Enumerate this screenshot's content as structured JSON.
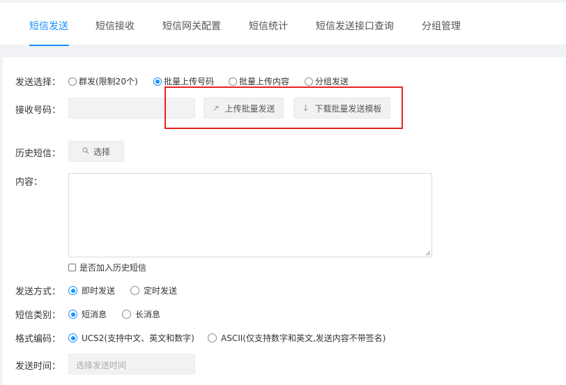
{
  "tabs": [
    {
      "label": "短信发送",
      "active": true
    },
    {
      "label": "短信接收",
      "active": false
    },
    {
      "label": "短信网关配置",
      "active": false
    },
    {
      "label": "短信统计",
      "active": false
    },
    {
      "label": "短信发送接口查询",
      "active": false
    },
    {
      "label": "分组管理",
      "active": false
    }
  ],
  "form": {
    "send_choice": {
      "label": "发送选择：",
      "options": [
        "群发(限制20个)",
        "批量上传号码",
        "批量上传内容",
        "分组发送"
      ],
      "selected": "批量上传号码"
    },
    "receive_number": {
      "label": "接收号码：",
      "value": "",
      "upload_button": "上传批量发送",
      "download_button": "下载批量发送模板"
    },
    "history": {
      "label": "历史短信：",
      "select_button": "选择"
    },
    "content": {
      "label": "内容：",
      "value": ""
    },
    "add_history_checkbox": {
      "label": "是否加入历史短信",
      "checked": false
    },
    "send_mode": {
      "label": "发送方式：",
      "options": [
        "即时发送",
        "定时发送"
      ],
      "selected": "即时发送"
    },
    "sms_type": {
      "label": "短信类别：",
      "options": [
        "短消息",
        "长消息"
      ],
      "selected": "短消息"
    },
    "encoding": {
      "label": "格式编码：",
      "options": [
        "UCS2(支持中文、英文和数字)",
        "ASCII(仅支持数字和英文,发送内容不带签名)"
      ],
      "selected": "UCS2(支持中文、英文和数字)"
    },
    "send_time": {
      "label": "发送时间：",
      "placeholder": "选择发送时间"
    }
  },
  "colors": {
    "accent": "#1890ff",
    "highlight_box": "#e32222"
  },
  "icons": {
    "upload": "arrow-up-right-icon",
    "download": "arrow-down-icon",
    "search": "search-icon"
  }
}
